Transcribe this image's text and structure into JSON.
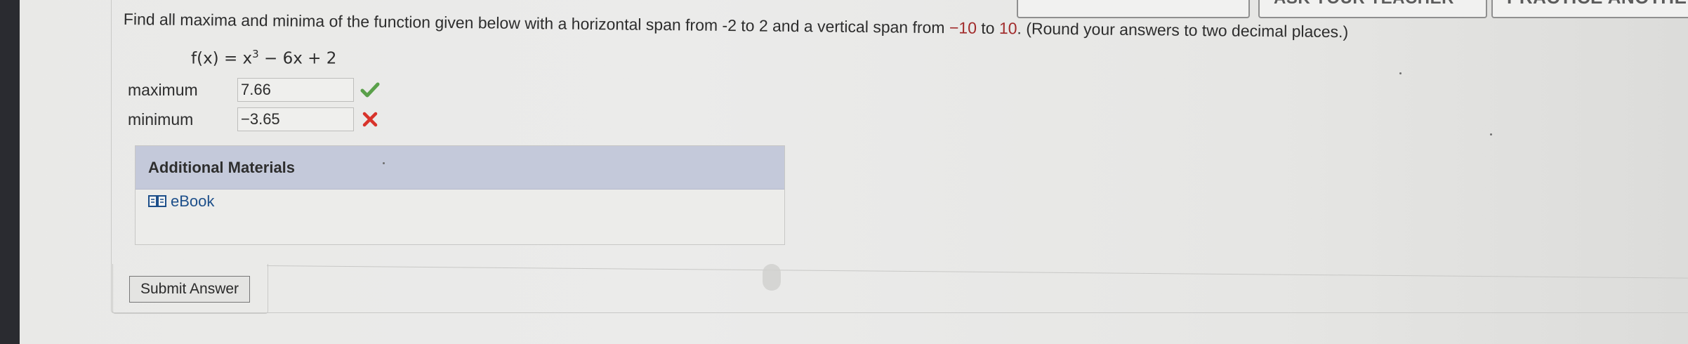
{
  "top_buttons": {
    "first_label": "",
    "ask_teacher_label": "ASK YOUR TEACHER",
    "practice_label": "PRACTICE ANOTHER"
  },
  "question": {
    "prefix": "Find all maxima and minima of the function given below with a horizontal span from -2 to 2 and a vertical span from ",
    "vspan_low": "−10",
    "middle": " to ",
    "vspan_high": "10",
    "suffix": ". (Round your answers to two decimal places.)",
    "function_lhs": "f(x) = x",
    "function_exponent": "3",
    "function_rhs": " − 6x + 2"
  },
  "answers": {
    "maximum_label": "maximum",
    "maximum_value": "7.66",
    "maximum_status": "correct",
    "minimum_label": "minimum",
    "minimum_value": "−3.65",
    "minimum_status": "incorrect"
  },
  "materials": {
    "header": "Additional Materials",
    "ebook_label": "eBook"
  },
  "submit": {
    "label": "Submit Answer"
  },
  "colors": {
    "correct_check": "#5aa04a",
    "incorrect_x": "#d8332b",
    "materials_header_bg": "#c4c9da",
    "highlight_red": "#a12b2b",
    "link_blue": "#1d4f8a"
  },
  "icons": {
    "correct": "check-icon",
    "incorrect": "x-icon",
    "ebook": "book-icon"
  }
}
